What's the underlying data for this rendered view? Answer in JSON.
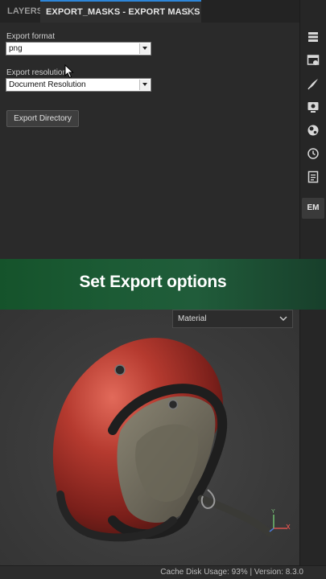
{
  "tabs": {
    "layers": "LAYERS",
    "export_masks": "EXPORT_MASKS - EXPORT MASKS"
  },
  "export_format": {
    "label": "Export format",
    "value": "png"
  },
  "export_resolution": {
    "label": "Export resolution",
    "value": "Document Resolution"
  },
  "export_directory_button": "Export Directory",
  "right_toolbar": {
    "icons": [
      "layers-stack-icon",
      "texture-set-icon",
      "brush-icon",
      "display-settings-icon",
      "shader-sphere-icon",
      "history-icon",
      "log-icon"
    ],
    "em_label": "EM"
  },
  "banner": {
    "text": "Set Export options",
    "color": "#1c5b35"
  },
  "viewport": {
    "material_dropdown": "Material",
    "gizmo_label": "Y"
  },
  "status_bar": {
    "text": "Cache Disk Usage:   93% | Version: 8.3.0"
  },
  "colors": {
    "accent": "#2d86d9",
    "helmet": "#b03a2e"
  }
}
